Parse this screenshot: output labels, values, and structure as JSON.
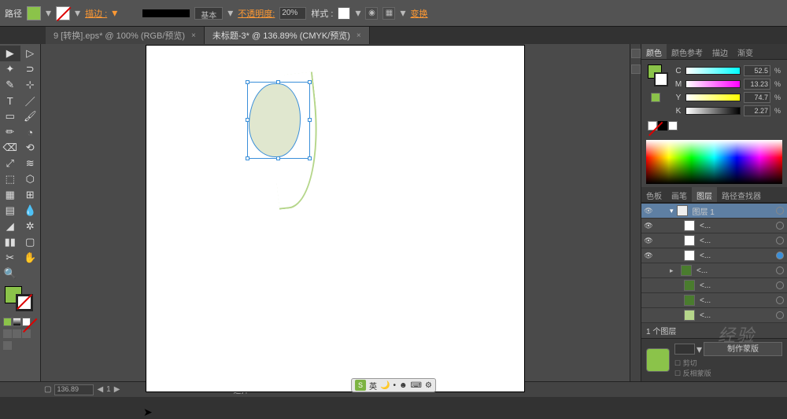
{
  "topbar": {
    "path_label": "路径",
    "stroke_label": "描边 :",
    "basic_label": "基本",
    "opacity_label": "不透明度:",
    "opacity_value": "20%",
    "style_label": "样式 :",
    "transform_link": "变换"
  },
  "tabs": [
    {
      "label": "9 [转换].eps* @ 100% (RGB/预览)",
      "active": false
    },
    {
      "label": "未标题-3* @ 136.89% (CMYK/预览)",
      "active": true
    }
  ],
  "color_panel": {
    "tabs": [
      "颜色",
      "颜色参考",
      "描边",
      "渐变"
    ],
    "channels": [
      {
        "label": "C",
        "value": "52.5"
      },
      {
        "label": "M",
        "value": "13.23"
      },
      {
        "label": "Y",
        "value": "74.7"
      },
      {
        "label": "K",
        "value": "2.27"
      }
    ],
    "percent": "%"
  },
  "layer_panel": {
    "tabs": [
      "色板",
      "画笔",
      "图层",
      "路径查找器"
    ],
    "header": "图层 1",
    "sublayer": "<...",
    "count": "1 个图层"
  },
  "mask_panel": {
    "make_mask": "制作蒙版",
    "clip": "剪切",
    "invert": "反相蒙版"
  },
  "status": {
    "zoom": "136.89",
    "select_label": "选择"
  },
  "ime": {
    "label": "英"
  },
  "watermark": "经验"
}
